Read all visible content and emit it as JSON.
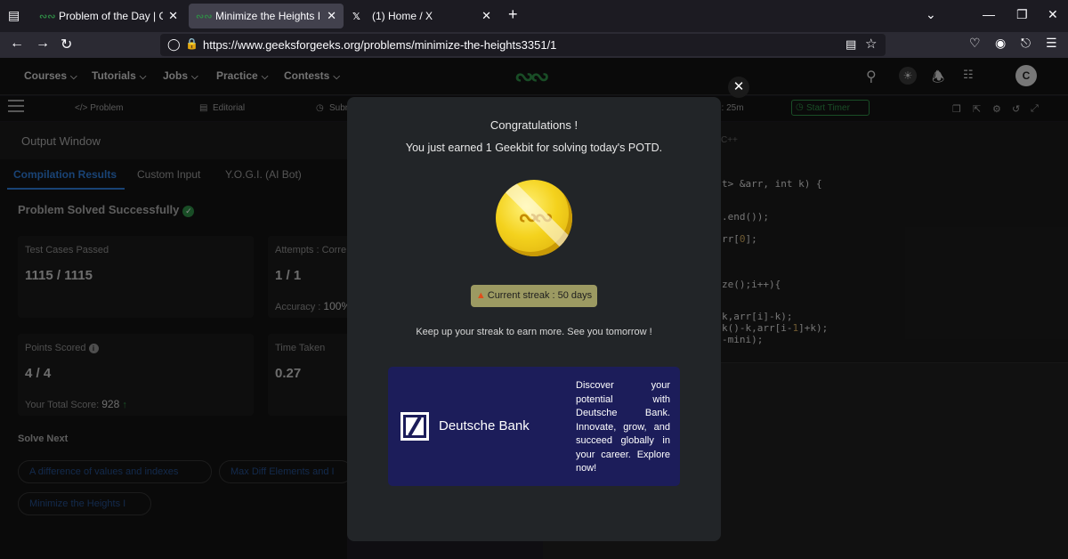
{
  "browser": {
    "tabs": [
      {
        "title": "Problem of the Day | GeeksforG",
        "favicon": "gfg-favicon",
        "active": false
      },
      {
        "title": "Minimize the Heights II | Practic",
        "favicon": "gfg-favicon",
        "active": true
      },
      {
        "title": "(1) Home / X",
        "favicon": "x-favicon",
        "active": false
      }
    ],
    "url": "https://www.geeksforgeeks.org/problems/minimize-the-heights3351/1"
  },
  "header": {
    "menu": [
      {
        "label": "Courses"
      },
      {
        "label": "Tutorials"
      },
      {
        "label": "Jobs"
      },
      {
        "label": "Practice"
      },
      {
        "label": "Contests"
      }
    ],
    "avatar_initial": "C"
  },
  "subtabs": {
    "problem": "</> Problem",
    "editorial": "Editorial",
    "submissions": "Subm",
    "timer": "e: 25m",
    "start_timer": "Start Timer"
  },
  "left": {
    "output_window": "Output Window",
    "tabs": [
      "Compilation Results",
      "Custom Input",
      "Y.O.G.I. (AI Bot)"
    ],
    "solved": "Problem Solved Successfully",
    "cards": {
      "test_cases_label": "Test Cases Passed",
      "test_cases_value": "1115 / 1115",
      "attempts_label": "Attempts : Corre",
      "attempts_value": "1 / 1",
      "accuracy_label": "Accuracy :",
      "accuracy_value": "100%",
      "points_label": "Points Scored",
      "points_value": "4 / 4",
      "total_score_label": "Your Total Score:",
      "total_score_value": "928",
      "time_label": "Time Taken",
      "time_value": "0.27"
    },
    "solve_next": "Solve Next",
    "chips": [
      "A difference of values and indexes",
      "Max Diff Elements and I",
      "Minimize the Heights I"
    ]
  },
  "editor": {
    "language": "C++",
    "lines": [
      {
        "pre": "t> &arr, int k) {",
        "num": ""
      },
      {
        "pre": ".end());",
        "num": ""
      },
      {
        "pre": "rr[",
        "num": "0",
        "post": "];"
      },
      {
        "pre": "ze();i++){",
        "num": ""
      },
      {
        "pre": "k,arr[i]-k);",
        "num": ""
      },
      {
        "pre": "k()-k,arr[i-",
        "num": "1",
        "post": "]+k);"
      },
      {
        "pre": "-mini);",
        "num": ""
      }
    ]
  },
  "modal": {
    "title": "Congratulations !",
    "message": "You just earned 1 Geekbit for solving today's POTD.",
    "streak": "Current streak : 50 days",
    "keep_up": "Keep up your streak to earn more. See you tomorrow !",
    "ad_brand": "Deutsche Bank",
    "ad_text": "Discover your potential with Deutsche Bank. Innovate, grow, and succeed globally in your career. Explore now!"
  },
  "colors": {
    "gfg_green": "#2f8d46",
    "link_blue": "#2f7bd6",
    "ad_navy": "#1c1d5a",
    "coin_gold": "#f4d21d"
  }
}
